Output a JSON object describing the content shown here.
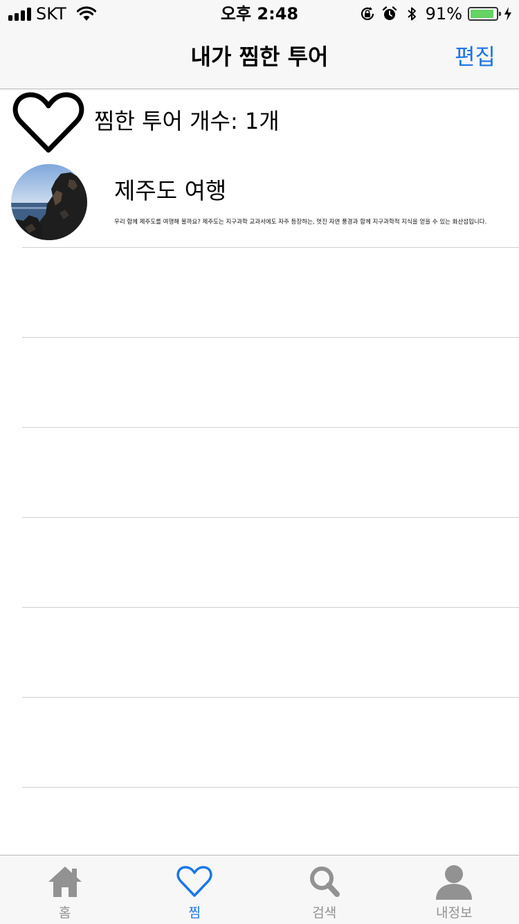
{
  "status_bar": {
    "carrier": "SKT",
    "time": "오후 2:48",
    "battery_percent": "91%",
    "battery_level": 0.91,
    "icons": [
      "signal-icon",
      "wifi-icon",
      "orientation-lock-icon",
      "alarm-icon",
      "bluetooth-icon",
      "battery-icon",
      "charging-icon"
    ]
  },
  "nav": {
    "title": "내가 찜한 투어",
    "edit_label": "편집"
  },
  "favorites": {
    "count_label": "찜한 투어 개수: 1개",
    "icon": "heart-outline-icon"
  },
  "tours": [
    {
      "title": "제주도 여행",
      "description": "우리 함께 제주도를 여행해 볼까요? 제주도는 지구과학 교과서에도 자주 등장하는, 멋진 자연 풍경과 함께 지구과학적 지식을 얻을 수 있는 화산섬입니다."
    }
  ],
  "tab_bar": {
    "tabs": [
      {
        "label": "홈",
        "icon": "home-icon",
        "active": false
      },
      {
        "label": "찜",
        "icon": "heart-icon",
        "active": true
      },
      {
        "label": "검색",
        "icon": "search-icon",
        "active": false
      },
      {
        "label": "내정보",
        "icon": "person-icon",
        "active": false
      }
    ]
  },
  "colors": {
    "accent": "#1a76e8",
    "inactive": "#929292",
    "bar_background": "#f7f7f7",
    "battery": "#65d265"
  }
}
